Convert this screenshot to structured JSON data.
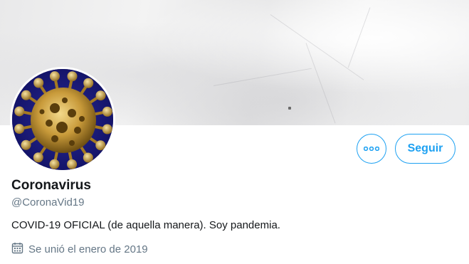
{
  "profile": {
    "display_name": "Coronavirus",
    "handle": "@CoronaVid19",
    "bio": "COVID-19 OFICIAL (de aquella manera). Soy pandemia.",
    "joined": "Se unió el enero de 2019"
  },
  "actions": {
    "follow_label": "Seguir",
    "more_icon": "more-dots-icon"
  },
  "icons": {
    "calendar": "calendar-icon"
  },
  "colors": {
    "accent": "#1da1f2",
    "text_primary": "#14171a",
    "text_secondary": "#657786"
  }
}
